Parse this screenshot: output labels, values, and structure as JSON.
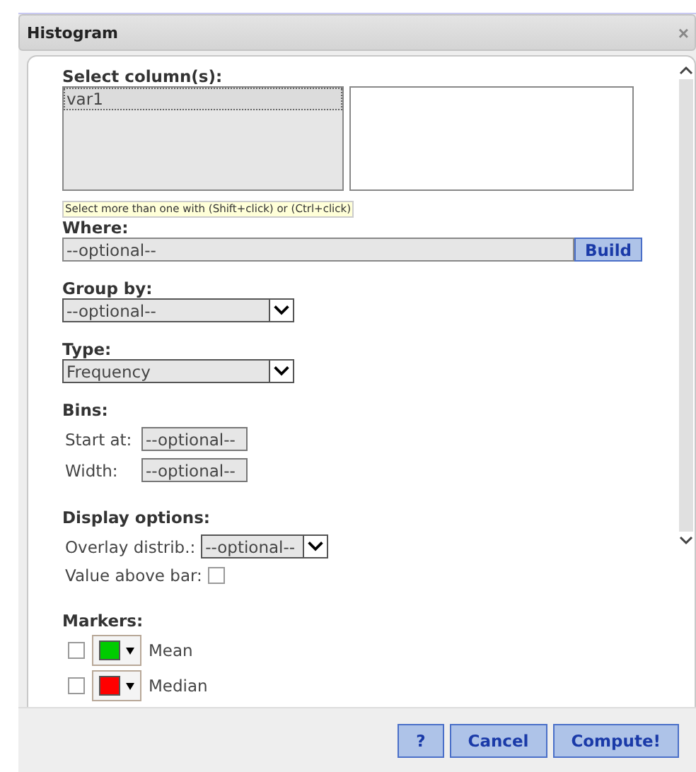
{
  "window": {
    "title": "Histogram",
    "close": "×"
  },
  "select_columns": {
    "label": "Select column(s):",
    "available": [
      {
        "name": "var1",
        "selected": true
      }
    ],
    "hint": "Select more than one with (Shift+click) or (Ctrl+click)"
  },
  "where": {
    "label": "Where:",
    "placeholder": "--optional--",
    "button": "Build"
  },
  "group_by": {
    "label": "Group by:",
    "value": "--optional--"
  },
  "type": {
    "label": "Type:",
    "value": "Frequency"
  },
  "bins": {
    "label": "Bins:",
    "fields": [
      {
        "label": "Start at:",
        "placeholder": "--optional--"
      },
      {
        "label": "Width:",
        "placeholder": "--optional--"
      }
    ]
  },
  "display_options": {
    "label": "Display options:",
    "overlay": {
      "label": "Overlay distrib.:",
      "value": "--optional--"
    },
    "value_above_bar": {
      "label": "Value above bar:",
      "checked": false
    }
  },
  "markers": {
    "label": "Markers:",
    "items": [
      {
        "name": "Mean",
        "checked": false,
        "color": "#00cc00"
      },
      {
        "name": "Median",
        "checked": false,
        "color": "#ff0000"
      }
    ]
  },
  "buttons": [
    {
      "label": "?"
    },
    {
      "label": "Cancel"
    },
    {
      "label": "Compute!"
    }
  ]
}
